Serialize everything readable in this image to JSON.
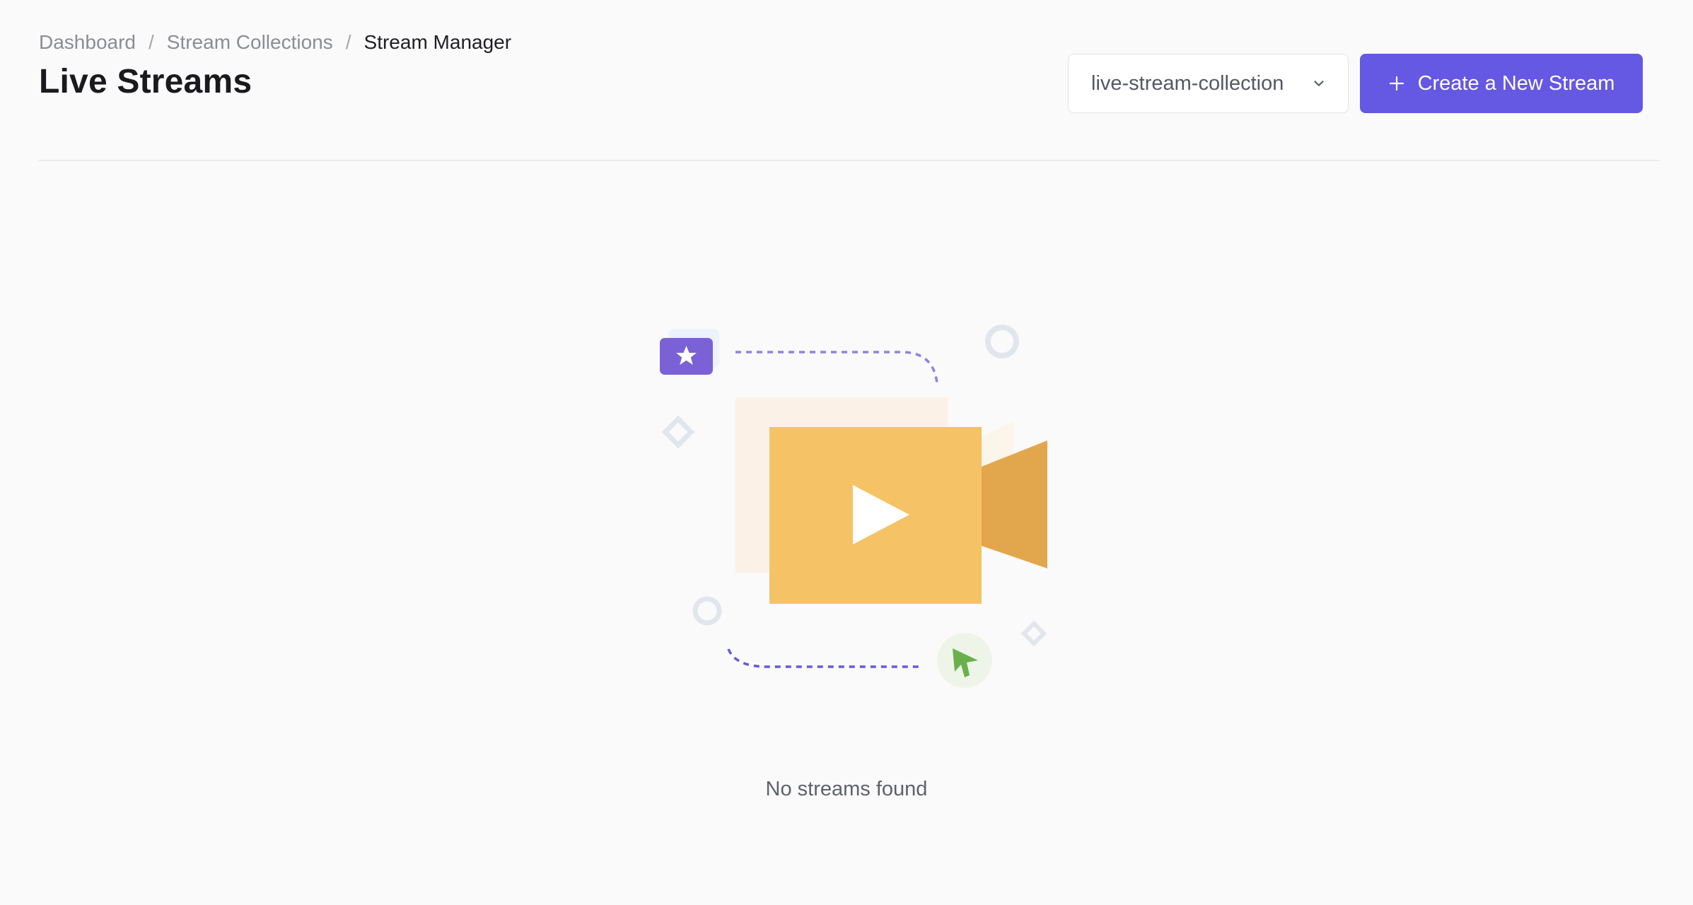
{
  "breadcrumb": {
    "items": [
      {
        "label": "Dashboard"
      },
      {
        "label": "Stream Collections"
      },
      {
        "label": "Stream Manager"
      }
    ],
    "separator": "/"
  },
  "header": {
    "title": "Live Streams"
  },
  "collection_select": {
    "selected": "live-stream-collection",
    "icon": "chevron-down-icon"
  },
  "create_button": {
    "label": "Create a New Stream",
    "icon": "plus-icon"
  },
  "empty_state": {
    "message": "No streams found",
    "illustration_icon": "video-camera-icon"
  },
  "colors": {
    "primary": "#6558e3",
    "camera_body": "#f5c265",
    "camera_lens": "#e2a74d",
    "star_badge": "#7b61d6",
    "cursor_green": "#6ab04c"
  }
}
